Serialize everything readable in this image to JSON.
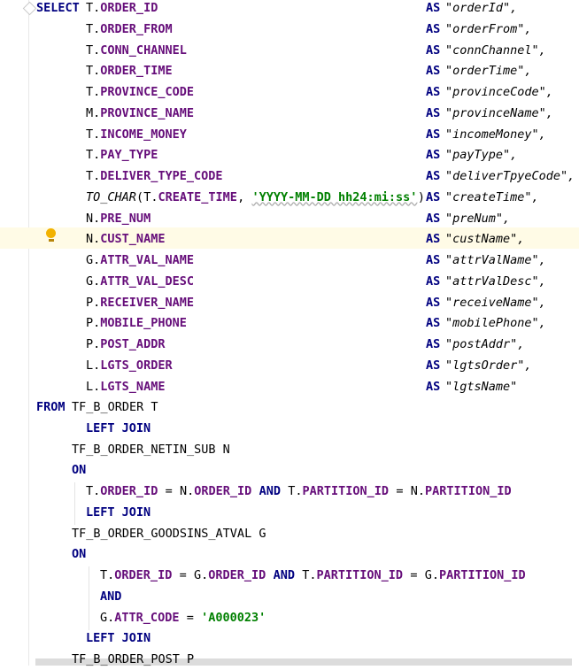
{
  "select": {
    "keyword": "SELECT",
    "as_kw": "AS",
    "rows": [
      {
        "table": "T.",
        "column": "ORDER_ID",
        "alias": "\"orderId\","
      },
      {
        "table": "T.",
        "column": "ORDER_FROM",
        "alias": "\"orderFrom\","
      },
      {
        "table": "T.",
        "column": "CONN_CHANNEL",
        "alias": "\"connChannel\","
      },
      {
        "table": "T.",
        "column": "ORDER_TIME",
        "alias": "\"orderTime\","
      },
      {
        "table": "T.",
        "column": "PROVINCE_CODE",
        "alias": "\"provinceCode\","
      },
      {
        "table": "M.",
        "column": "PROVINCE_NAME",
        "alias": "\"provinceName\","
      },
      {
        "table": "T.",
        "column": "INCOME_MONEY",
        "alias": "\"incomeMoney\","
      },
      {
        "table": "T.",
        "column": "PAY_TYPE",
        "alias": "\"payType\","
      },
      {
        "table": "T.",
        "column": "DELIVER_TYPE_CODE",
        "alias": "\"deliverTpyeCode\","
      },
      {
        "func": "TO_CHAR",
        "open": "(",
        "table": "T.",
        "column": "CREATE_TIME",
        "sep": ", ",
        "string": "'YYYY-MM-DD hh24:mi:ss'",
        "close": ")",
        "alias": "\"createTime\","
      },
      {
        "table": "N.",
        "column": "PRE_NUM",
        "alias": "\"preNum\","
      },
      {
        "table": "N.",
        "column": "CUST_NAME",
        "alias": "\"custName\","
      },
      {
        "table": "G.",
        "column": "ATTR_VAL_NAME",
        "alias": "\"attrValName\","
      },
      {
        "table": "G.",
        "column": "ATTR_VAL_DESC",
        "alias": "\"attrValDesc\","
      },
      {
        "table": "P.",
        "column": "RECEIVER_NAME",
        "alias": "\"receiveName\","
      },
      {
        "table": "P.",
        "column": "MOBILE_PHONE",
        "alias": "\"mobilePhone\","
      },
      {
        "table": "P.",
        "column": "POST_ADDR",
        "alias": "\"postAddr\","
      },
      {
        "table": "L.",
        "column": "LGTS_ORDER",
        "alias": "\"lgtsOrder\","
      },
      {
        "table": "L.",
        "column": "LGTS_NAME",
        "alias": "\"lgtsName\""
      }
    ]
  },
  "from": {
    "keyword": "FROM",
    "table": "TF_B_ORDER T",
    "join1": "LEFT JOIN",
    "table1": "TF_B_ORDER_NETIN_SUB N",
    "on": "ON",
    "cond1": {
      "a_tbl": "T.",
      "a_col": "ORDER_ID",
      "eq": " = ",
      "b_tbl": "N.",
      "b_col": "ORDER_ID",
      "and": "AND",
      "c_tbl": "T.",
      "c_col": "PARTITION_ID",
      "d_tbl": "N.",
      "d_col": "PARTITION_ID"
    },
    "join2": "LEFT JOIN",
    "table2": "TF_B_ORDER_GOODSINS_ATVAL G",
    "cond2": {
      "a_tbl": "T.",
      "a_col": "ORDER_ID",
      "eq": " = ",
      "b_tbl": "G.",
      "b_col": "ORDER_ID",
      "and": "AND",
      "c_tbl": "T.",
      "c_col": "PARTITION_ID",
      "d_tbl": "G.",
      "d_col": "PARTITION_ID"
    },
    "and2": "AND",
    "cond3": {
      "tbl": "G.",
      "col": "ATTR_CODE",
      "eq": " = ",
      "str": "'A000023'"
    },
    "join3": "LEFT JOIN",
    "table3": "TF_B_ORDER_POST P"
  },
  "colors": {
    "keyword": "#000080",
    "field": "#660e7a",
    "string": "#008000",
    "highlight": "#fffbe6"
  },
  "icons": {
    "intention": "lightbulb-icon",
    "fold": "fold-marker-icon"
  }
}
